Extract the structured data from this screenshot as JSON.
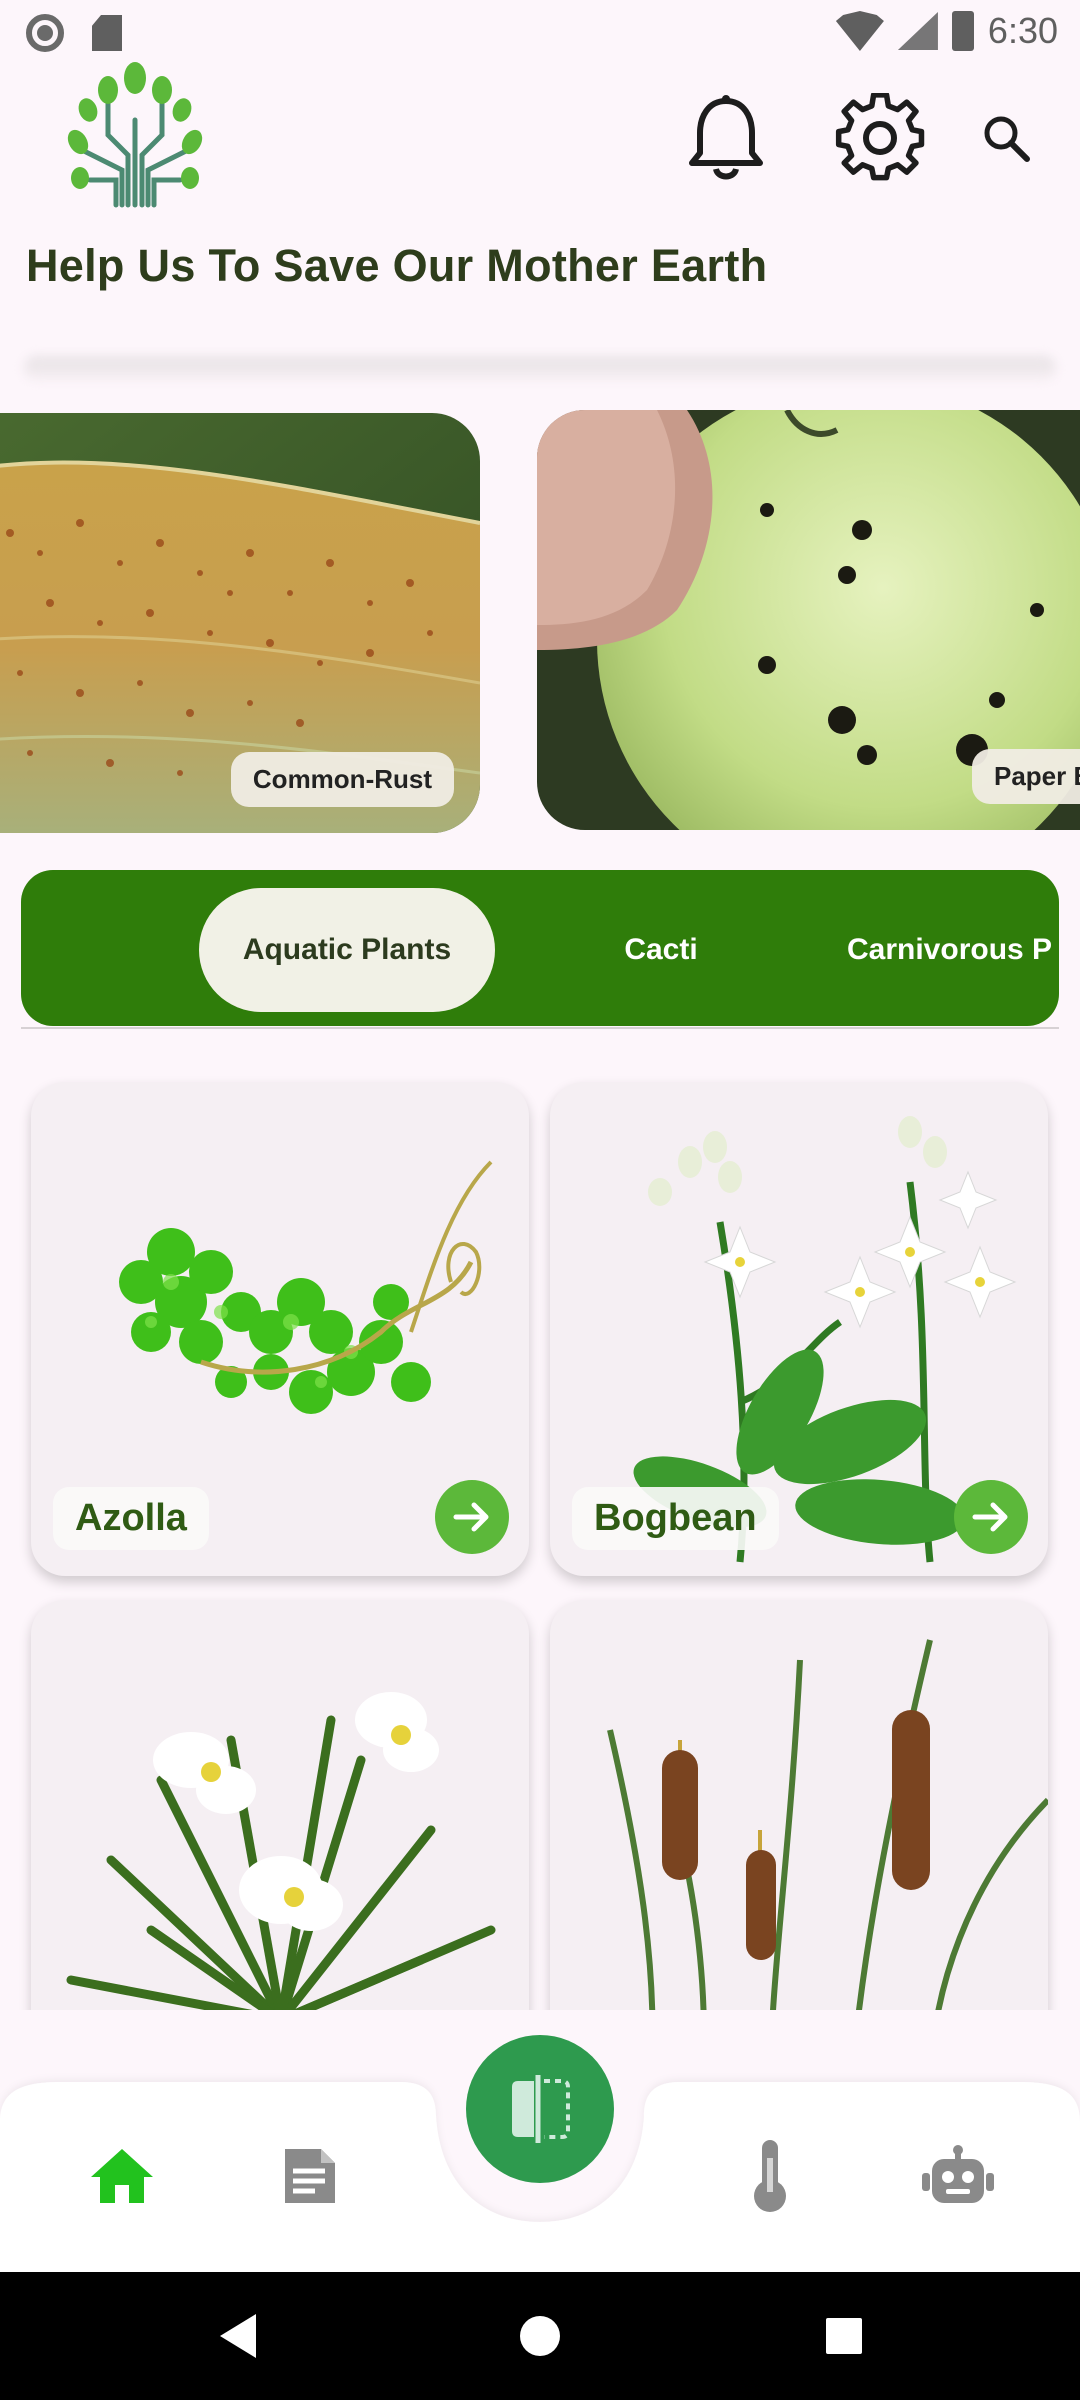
{
  "status_bar": {
    "time": "6:30"
  },
  "header": {
    "headline": "Help Us To Save Our Mother Earth"
  },
  "carousel": {
    "slides": [
      {
        "label": "Common-Rust"
      },
      {
        "label": "Paper B"
      }
    ]
  },
  "categories": {
    "tabs": [
      {
        "label": "Aquatic Plants",
        "active": true
      },
      {
        "label": "Cacti",
        "active": false
      },
      {
        "label": "Carnivorous P",
        "active": false
      }
    ]
  },
  "plants": [
    {
      "name": "Azolla"
    },
    {
      "name": "Bogbean"
    }
  ],
  "colors": {
    "accent_green": "#2f7d0a",
    "fab_green": "#2e9a4e",
    "home_active": "#22c21e",
    "nav_inactive": "#8a8a8a"
  },
  "icons": {
    "bell": "bell-icon",
    "gear": "gear-icon",
    "search": "search-icon",
    "home": "home-icon",
    "docs": "document-icon",
    "temp": "thermometer-icon",
    "bot": "robot-icon",
    "scan": "scan-icon"
  }
}
